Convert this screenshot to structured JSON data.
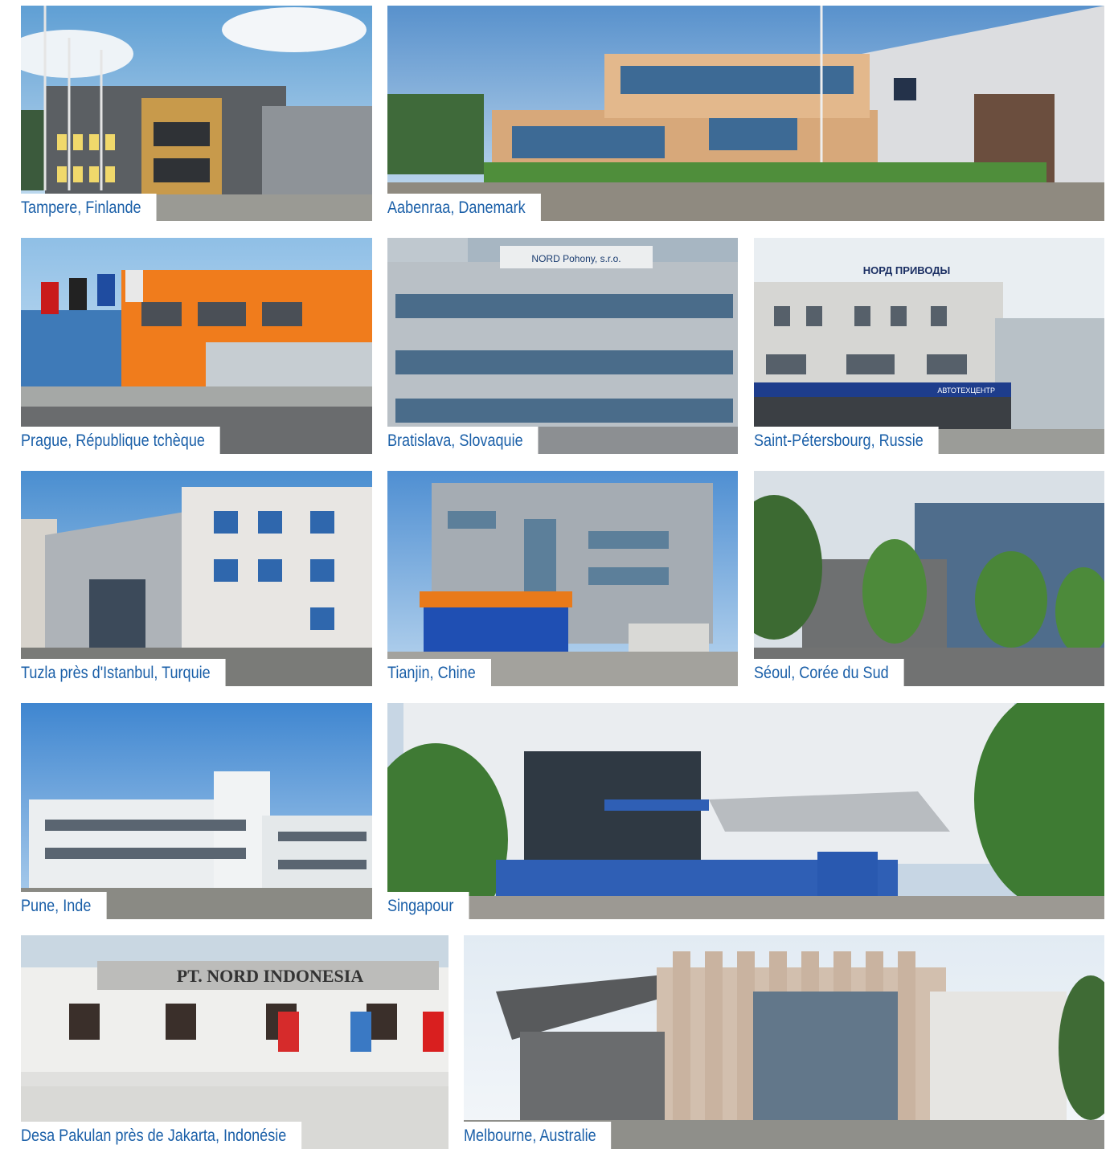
{
  "photos": [
    {
      "caption": "Tampere, Finlande"
    },
    {
      "caption": "Aabenraa, Danemark"
    },
    {
      "caption": "Prague, République tchèque"
    },
    {
      "caption": "Bratislava, Slovaquie"
    },
    {
      "caption": "Saint-Pétersbourg, Russie"
    },
    {
      "caption": "Tuzla près d'Istanbul, Turquie"
    },
    {
      "caption": "Tianjin, Chine"
    },
    {
      "caption": "Séoul, Corée du Sud"
    },
    {
      "caption": "Pune, Inde"
    },
    {
      "caption": "Singapour"
    },
    {
      "caption": "Desa Pakulan près de Jakarta, Indonésie"
    },
    {
      "caption": "Melbourne, Australie"
    }
  ],
  "signage": {
    "bratislava": "NORD Pohony, s.r.o.",
    "saint_petersburg": "НОРД ПРИВОДЫ",
    "saint_petersburg_shop": "АВТОТЕХЦЕНТР",
    "jakarta": "PT. NORD INDONESIA"
  },
  "colors": {
    "caption_text": "#1a5fa8",
    "caption_bg": "#ffffff"
  }
}
